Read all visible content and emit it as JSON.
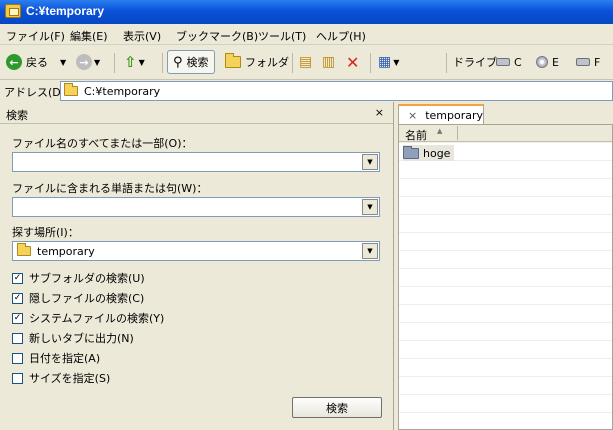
{
  "window": {
    "title": "C:¥temporary"
  },
  "menu": [
    "ファイル(F)",
    "編集(E)",
    "表示(V)",
    "ブックマーク(B)",
    "ツール(T)",
    "ヘルプ(H)"
  ],
  "toolbar": {
    "back_label": "戻る",
    "search_label": "検索",
    "folder_label": "フォルダ",
    "drive_label": "ドライブ",
    "drives": [
      "C",
      "E",
      "F"
    ]
  },
  "address": {
    "label": "アドレス(D)",
    "value": "C:¥temporary"
  },
  "search_panel": {
    "title": "検索",
    "close": "×",
    "filename_label": "ファイル名のすべてまたは一部(O)：",
    "filename_value": "",
    "content_label": "ファイルに含まれる単語または句(W)：",
    "content_value": "",
    "location_label": "探す場所(I)：",
    "location_value": "temporary",
    "options": [
      {
        "label": "サブフォルダの検索(U)",
        "checked": true
      },
      {
        "label": "隠しファイルの検索(C)",
        "checked": true
      },
      {
        "label": "システムファイルの検索(Y)",
        "checked": true
      },
      {
        "label": "新しいタブに出力(N)",
        "checked": false
      },
      {
        "label": "日付を指定(A)",
        "checked": false
      },
      {
        "label": "サイズを指定(S)",
        "checked": false
      }
    ],
    "search_button": "検索"
  },
  "file_view": {
    "tab_close": "×",
    "tab_title": "temporary",
    "column_name": "名前",
    "items": [
      "hoge"
    ]
  },
  "colors": {
    "title_bar": "#0a52d9",
    "tab_accent": "#f7a23b"
  }
}
